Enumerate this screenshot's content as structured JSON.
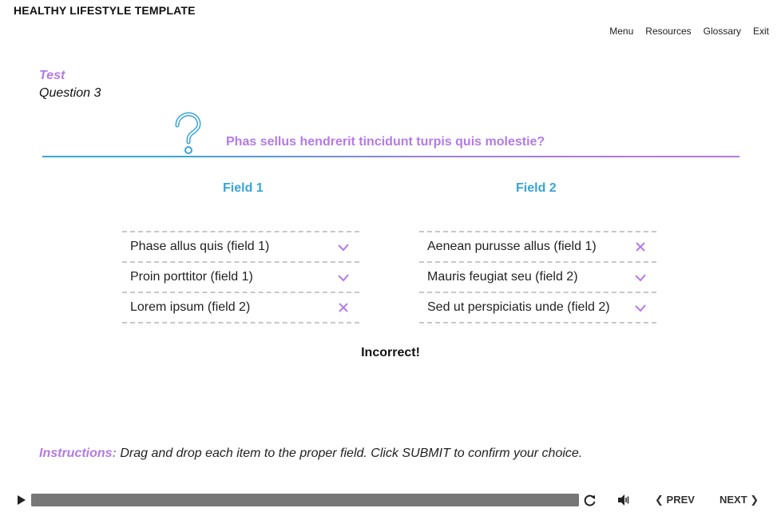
{
  "app": {
    "title": "HEALTHY LIFESTYLE TEMPLATE"
  },
  "nav": {
    "menu": "Menu",
    "resources": "Resources",
    "glossary": "Glossary",
    "exit": "Exit"
  },
  "section": {
    "label": "Test",
    "question_number": "Question 3"
  },
  "question": {
    "text": "Phas sellus hendrerit tincidunt turpis quis molestie?"
  },
  "fields": [
    {
      "header": "Field 1",
      "items": [
        {
          "label": "Phase allus quis (field 1)",
          "status": "correct"
        },
        {
          "label": "Proin porttitor (field 1)",
          "status": "correct"
        },
        {
          "label": "Lorem ipsum (field 2)",
          "status": "incorrect"
        }
      ]
    },
    {
      "header": "Field 2",
      "items": [
        {
          "label": "Aenean purusse allus (field 1)",
          "status": "incorrect"
        },
        {
          "label": "Mauris feugiat seu (field 2)",
          "status": "correct"
        },
        {
          "label": "Sed ut perspiciatis unde (field 2)",
          "status": "correct"
        }
      ]
    }
  ],
  "feedback": "Incorrect!",
  "instructions": {
    "label": "Instructions:",
    "text": " Drag and drop each item to the proper field. Click SUBMIT to confirm your choice."
  },
  "player": {
    "prev": "PREV",
    "next": "NEXT",
    "progress": 1.0
  },
  "colors": {
    "accent_purple": "#b47ae8",
    "accent_blue": "#3aa4d8",
    "progress_gray": "#888888"
  },
  "icons": {
    "correct": "check-icon",
    "incorrect": "cross-icon"
  }
}
